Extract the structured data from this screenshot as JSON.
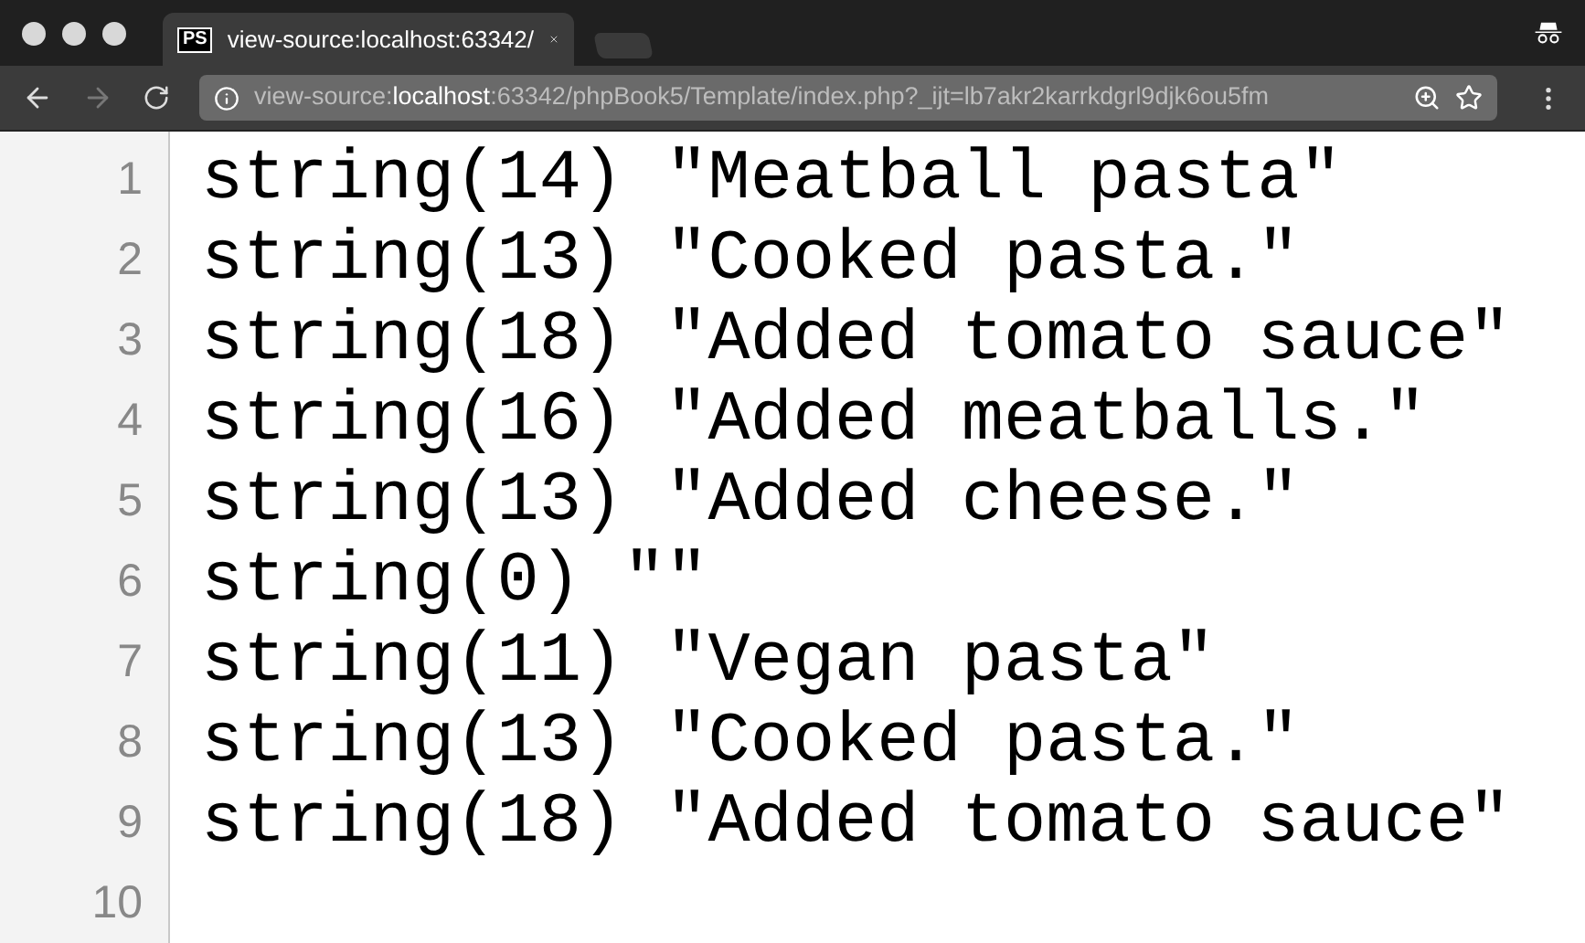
{
  "tab": {
    "icon_text": "PS",
    "title": "view-source:localhost:63342/",
    "selected": true
  },
  "address_bar": {
    "scheme": "view-source:",
    "host": "localhost",
    "rest": ":63342/phpBook5/Template/index.php?_ijt=lb7akr2karrkdgrl9djk6ou5fm"
  },
  "lines": [
    {
      "number": "1",
      "text": "string(14) \"Meatball pasta\""
    },
    {
      "number": "2",
      "text": "string(13) \"Cooked pasta.\""
    },
    {
      "number": "3",
      "text": "string(18) \"Added tomato sauce\""
    },
    {
      "number": "4",
      "text": "string(16) \"Added meatballs.\""
    },
    {
      "number": "5",
      "text": "string(13) \"Added cheese.\""
    },
    {
      "number": "6",
      "text": "string(0) \"\""
    },
    {
      "number": "7",
      "text": "string(11) \"Vegan pasta\""
    },
    {
      "number": "8",
      "text": "string(13) \"Cooked pasta.\""
    },
    {
      "number": "9",
      "text": "string(18) \"Added tomato sauce\""
    },
    {
      "number": "10"
    }
  ]
}
